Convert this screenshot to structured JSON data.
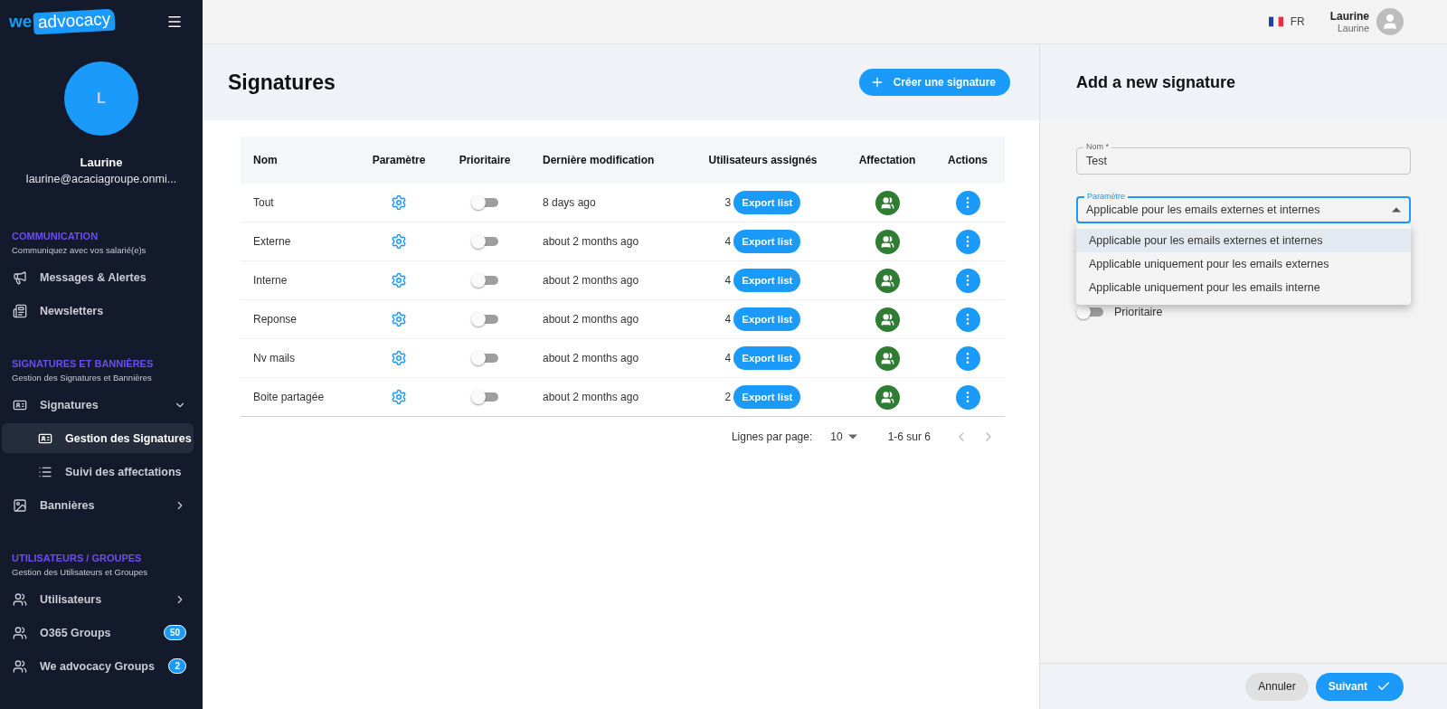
{
  "sidebar": {
    "logo": {
      "part_1": "we",
      "part_2": "advocacy"
    },
    "user": {
      "initial": "L",
      "name": "Laurine",
      "email": "laurine@acaciagroupe.onmi..."
    },
    "sections": [
      {
        "title": "COMMUNICATION",
        "subtitle": "Communiquez avec vos salarié(e)s",
        "items": [
          {
            "label": "Messages & Alertes"
          },
          {
            "label": "Newsletters"
          }
        ]
      },
      {
        "title": "SIGNATURES ET BANNIÈRES",
        "subtitle": "Gestion des Signatures et Bannières",
        "items": [
          {
            "label": "Signatures",
            "expanded": true,
            "children": [
              {
                "label": "Gestion des Signatures",
                "selected": true
              },
              {
                "label": "Suivi des affectations",
                "selected": false
              }
            ]
          },
          {
            "label": "Bannières",
            "expanded": false
          }
        ]
      },
      {
        "title": "UTILISATEURS / GROUPES",
        "subtitle": "Gestion des Utilisateurs et Groupes",
        "items": [
          {
            "label": "Utilisateurs",
            "expanded": false
          },
          {
            "label": "O365 Groups",
            "badge": "50"
          },
          {
            "label": "We advocacy Groups",
            "badge": "2"
          }
        ]
      }
    ]
  },
  "topbar": {
    "language": "FR",
    "user_name": "Laurine",
    "user_role": "Laurine"
  },
  "page": {
    "title": "Signatures",
    "create_button": "Créer une signature"
  },
  "table": {
    "columns": [
      "Nom",
      "Paramètre",
      "Prioritaire",
      "Dernière modification",
      "Utilisateurs assignés",
      "Affectation",
      "Actions"
    ],
    "rows": [
      {
        "name": "Tout",
        "prioritaire": false,
        "modified": "8 days ago",
        "users": "3",
        "export": "Export list"
      },
      {
        "name": "Externe",
        "prioritaire": false,
        "modified": "about 2 months ago",
        "users": "4",
        "export": "Export list"
      },
      {
        "name": "Interne",
        "prioritaire": false,
        "modified": "about 2 months ago",
        "users": "4",
        "export": "Export list"
      },
      {
        "name": "Reponse",
        "prioritaire": false,
        "modified": "about 2 months ago",
        "users": "4",
        "export": "Export list"
      },
      {
        "name": "Nv mails",
        "prioritaire": false,
        "modified": "about 2 months ago",
        "users": "4",
        "export": "Export list"
      },
      {
        "name": "Boite partagée",
        "prioritaire": false,
        "modified": "about 2 months ago",
        "users": "2",
        "export": "Export list"
      }
    ]
  },
  "pagination": {
    "label": "Lignes par page:",
    "per_page": "10",
    "range": "1-6 sur 6"
  },
  "panel": {
    "title": "Add a new signature",
    "name_field": {
      "label": "Nom *",
      "value": "Test"
    },
    "parametre_field": {
      "label": "Paramètre",
      "value": "Applicable pour les emails externes et internes",
      "expanded": true,
      "options": [
        {
          "label": "Applicable pour les emails externes et internes",
          "selected": true
        },
        {
          "label": "Applicable uniquement pour les emails externes",
          "selected": false
        },
        {
          "label": "Applicable uniquement pour les emails interne",
          "selected": false
        }
      ]
    },
    "priority_switch": {
      "label": "Prioritaire",
      "on": false
    },
    "cancel_button": "Annuler",
    "submit_button": "Suivant"
  }
}
